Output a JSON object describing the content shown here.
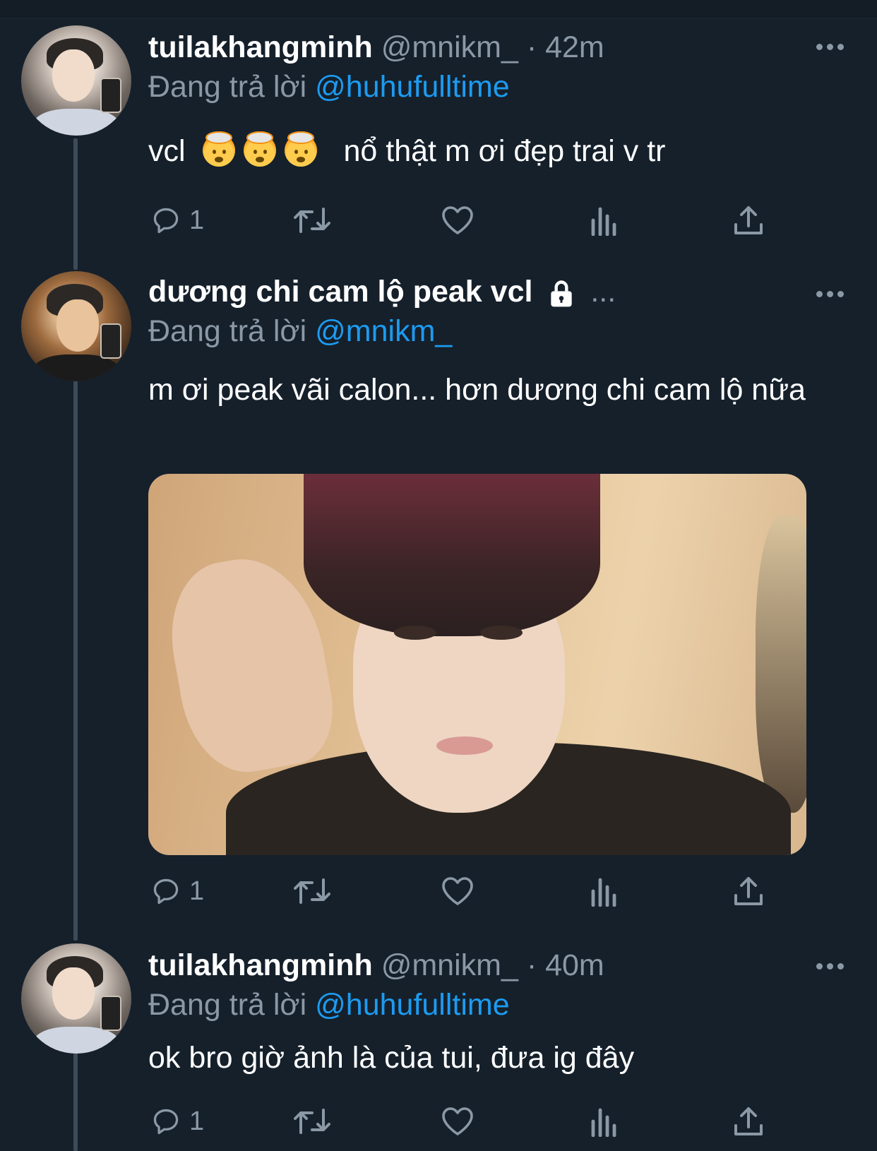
{
  "tweets": [
    {
      "name": "tuilakhangminh",
      "handle": "@mnikm_",
      "separator": "·",
      "time": "42m",
      "reply_prefix": "Đang trả lời",
      "reply_to": "@huhufulltime",
      "text_before_emoji": "vcl",
      "text_after_emoji": "nổ thật m ơi đẹp trai v tr",
      "emojis": [
        "exploding-head",
        "exploding-head",
        "exploding-head"
      ],
      "reply_count": "1"
    },
    {
      "name": "dương chi cam lộ peak vcl",
      "ellipsis": "...",
      "locked": true,
      "reply_prefix": "Đang trả lời",
      "reply_to": "@mnikm_",
      "text": "m ơi peak vãi calon... hơn dương chi cam lộ nữa",
      "has_media": true,
      "reply_count": "1"
    },
    {
      "name": "tuilakhangminh",
      "handle": "@mnikm_",
      "separator": "·",
      "time": "40m",
      "reply_prefix": "Đang trả lời",
      "reply_to": "@huhufulltime",
      "text": "ok bro giờ ảnh là của tui, đưa ig đây",
      "reply_count": "1"
    }
  ],
  "icons": [
    "reply-icon",
    "retweet-icon",
    "like-icon",
    "analytics-icon",
    "share-icon",
    "more-icon",
    "lock-icon"
  ],
  "colors": {
    "background": "#15202b",
    "muted": "#8b98a5",
    "link": "#1d9bf0",
    "thread_line": "#3d4a57"
  }
}
